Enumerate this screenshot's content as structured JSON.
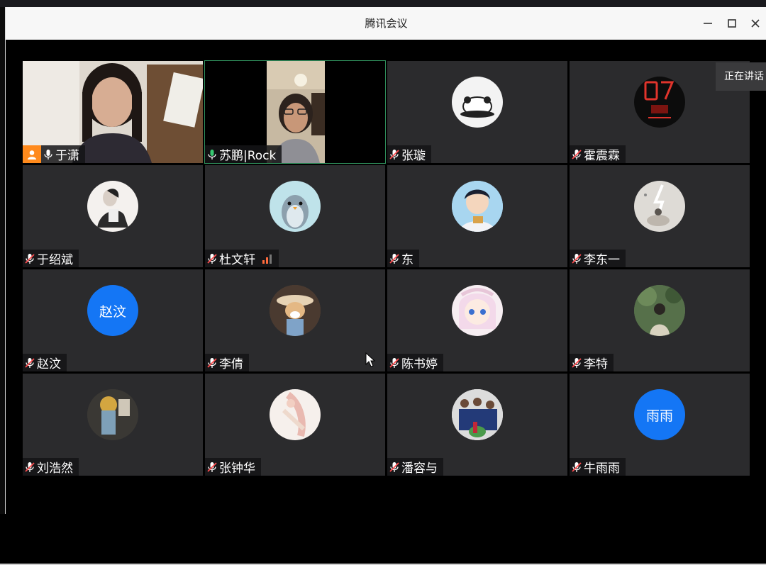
{
  "window": {
    "title": "腾讯会议"
  },
  "speaking_indicator": "正在讲话",
  "participants": [
    {
      "name": "于潇",
      "video": true,
      "host": true,
      "mic": "on"
    },
    {
      "name": "苏鹏|Rock",
      "video": true,
      "mic": "on",
      "speaking": true
    },
    {
      "name": "张璇",
      "mic": "muted"
    },
    {
      "name": "霍震霖",
      "mic": "muted"
    },
    {
      "name": "于绍斌",
      "mic": "muted"
    },
    {
      "name": "杜文轩",
      "mic": "muted",
      "signal": true
    },
    {
      "name": "东",
      "mic": "muted"
    },
    {
      "name": "李东一",
      "mic": "muted"
    },
    {
      "name": "赵汶",
      "mic": "muted",
      "avatar_text": "赵汶",
      "avatar_color": "#1476f5"
    },
    {
      "name": "李倩",
      "mic": "muted"
    },
    {
      "name": "陈书婷",
      "mic": "muted"
    },
    {
      "name": "李特",
      "mic": "muted"
    },
    {
      "name": "刘浩然",
      "mic": "muted"
    },
    {
      "name": "张钟华",
      "mic": "muted"
    },
    {
      "name": "潘容与",
      "mic": "muted"
    },
    {
      "name": "牛雨雨",
      "mic": "muted",
      "avatar_text": "雨雨",
      "avatar_color": "#1476f5"
    }
  ]
}
